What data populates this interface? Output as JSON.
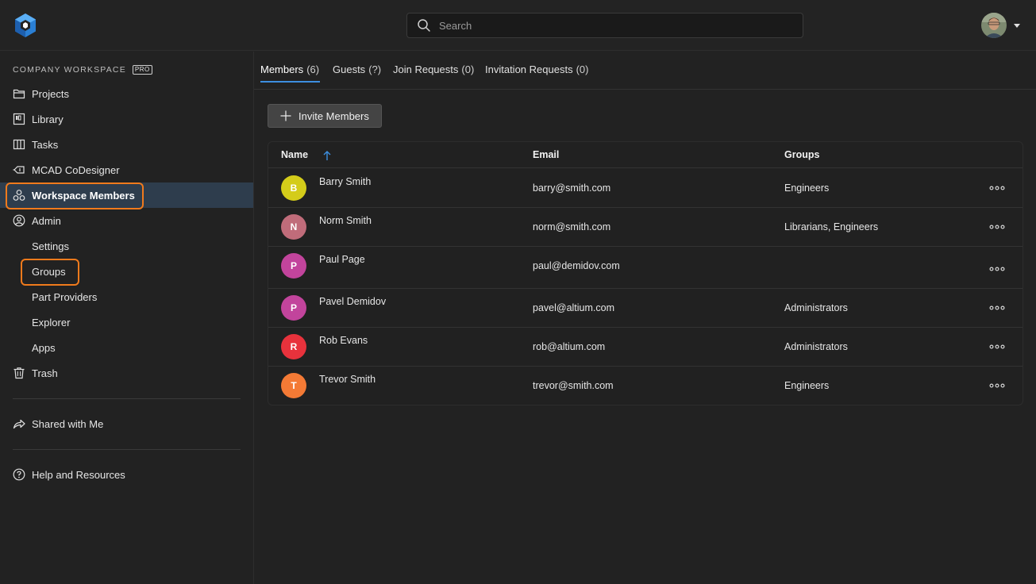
{
  "header": {
    "search_placeholder": "Search"
  },
  "sidebar": {
    "workspace_label": "COMPANY WORKSPACE",
    "pro_badge": "PRO",
    "items": [
      {
        "label": "Projects",
        "icon": "folder-icon"
      },
      {
        "label": "Library",
        "icon": "library-icon"
      },
      {
        "label": "Tasks",
        "icon": "tasks-icon"
      },
      {
        "label": "MCAD CoDesigner",
        "icon": "mcad-icon"
      },
      {
        "label": "Workspace Members",
        "icon": "members-icon",
        "active": true
      },
      {
        "label": "Admin",
        "icon": "user-circle-icon"
      },
      {
        "label": "Settings"
      },
      {
        "label": "Groups"
      },
      {
        "label": "Part Providers"
      },
      {
        "label": "Explorer"
      },
      {
        "label": "Apps"
      },
      {
        "label": "Trash",
        "icon": "trash-icon"
      },
      {
        "label": "Shared with Me",
        "icon": "share-icon"
      },
      {
        "label": "Help and Resources",
        "icon": "help-icon"
      }
    ]
  },
  "tabs": [
    {
      "label": "Members",
      "count": "(6)",
      "active": true
    },
    {
      "label": "Guests",
      "count": "(?)"
    },
    {
      "label": "Join Requests",
      "count": "(0)"
    },
    {
      "label": "Invitation Requests",
      "count": "(0)"
    }
  ],
  "invite_button": "Invite Members",
  "table": {
    "columns": {
      "name": "Name",
      "email": "Email",
      "groups": "Groups"
    },
    "rows": [
      {
        "initial": "B",
        "name": "Barry Smith",
        "email": "barry@smith.com",
        "groups": "Engineers",
        "color": "#d4cc1a"
      },
      {
        "initial": "N",
        "name": "Norm Smith",
        "email": "norm@smith.com",
        "groups": "Librarians, Engineers",
        "color": "#c06c7a"
      },
      {
        "initial": "P",
        "name": "Paul Page",
        "email": "paul@demidov.com",
        "groups": "",
        "color": "#c2449c"
      },
      {
        "initial": "P",
        "name": "Pavel Demidov",
        "email": "pavel@altium.com",
        "groups": "Administrators",
        "color": "#c2449c"
      },
      {
        "initial": "R",
        "name": "Rob Evans",
        "email": "rob@altium.com",
        "groups": "Administrators",
        "color": "#e8323c"
      },
      {
        "initial": "T",
        "name": "Trevor Smith",
        "email": "trevor@smith.com",
        "groups": "Engineers",
        "color": "#f47a35"
      }
    ]
  },
  "colors": {
    "accent": "#3d8fe0",
    "highlight": "#f07a1c",
    "active_bg": "#2e3d4d"
  }
}
